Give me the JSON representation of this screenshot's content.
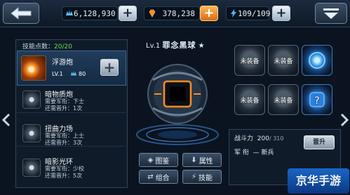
{
  "topbar": {
    "crystals": "6,128,930",
    "gems": "378,238",
    "energy": "109/109"
  },
  "skills_panel": {
    "points_label": "技能点数：",
    "points_value": "20/20",
    "selected": {
      "name": "浮游炮",
      "level": "LV.1",
      "cost": "80"
    },
    "items": [
      {
        "name": "暗物质炮",
        "req1": "需要军衔：下士",
        "req2": "还需晋升：1次"
      },
      {
        "name": "扭曲力场",
        "req1": "需要军衔：上士",
        "req2": "还需晋升：3次"
      },
      {
        "name": "暗影光环",
        "req1": "需要军衔：少校",
        "req2": "还需晋升：5次"
      }
    ]
  },
  "unit": {
    "level": "Lv.1",
    "name": "罪念黑球"
  },
  "center_buttons": {
    "gallery": "图鉴",
    "attributes": "属性",
    "combo": "组合",
    "skills": "技能"
  },
  "equipment": {
    "slots": [
      "未装备",
      "未装备",
      "",
      "未装备",
      "未装备",
      ""
    ]
  },
  "stats": {
    "power_label": "战斗力",
    "power_value": "200",
    "power_max": "310",
    "rank_label": "军 衔",
    "rank_value": "新兵",
    "upgrade_label": "晋升"
  },
  "watermark": "京华手游",
  "colors": {
    "accent_orange": "#ff9a2c",
    "accent_blue": "#3b7cc0",
    "points_green": "#6fdc5a"
  }
}
